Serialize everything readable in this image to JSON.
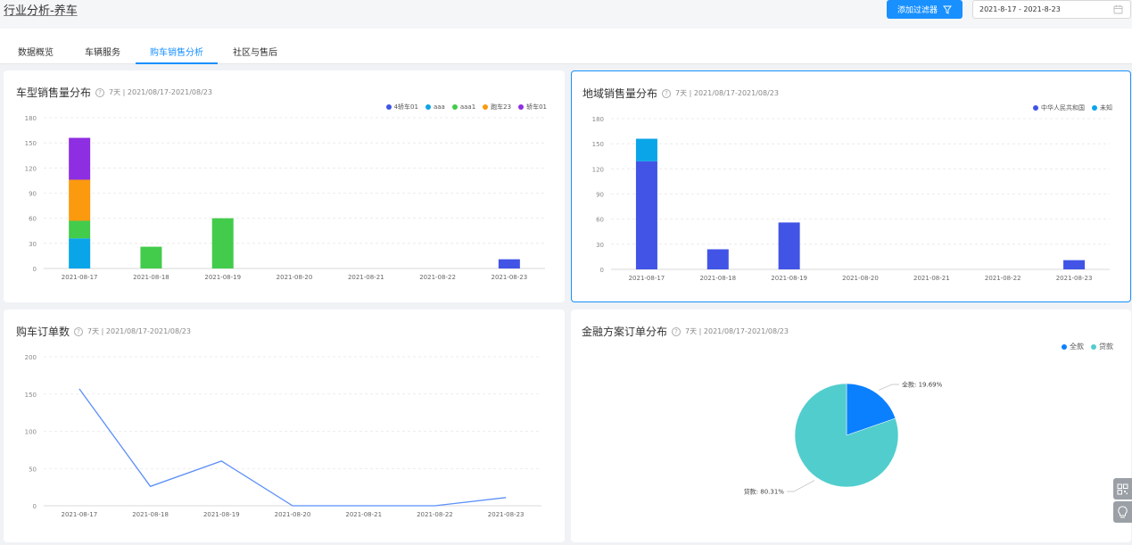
{
  "header": {
    "title": "行业分析-养车",
    "filter_button": "添加过滤器",
    "date_range": "2021-8-17 - 2021-8-23"
  },
  "tabs": [
    {
      "label": "数据概览",
      "active": false
    },
    {
      "label": "车辆服务",
      "active": false
    },
    {
      "label": "购车销售分析",
      "active": true
    },
    {
      "label": "社区与售后",
      "active": false
    }
  ],
  "cards": {
    "model_sales": {
      "title": "车型销售量分布",
      "help": "?",
      "meta": "7天 | 2021/08/17-2021/08/23"
    },
    "region_sales": {
      "title": "地域销售量分布",
      "help": "?",
      "meta": "7天 | 2021/08/17-2021/08/23"
    },
    "orders": {
      "title": "购车订单数",
      "help": "?",
      "meta": "7天 | 2021/08/17-2021/08/23"
    },
    "finance": {
      "title": "金融方案订单分布",
      "help": "?",
      "meta": "7天 | 2021/08/17-2021/08/23"
    }
  },
  "colors": {
    "accent": "#1890ff",
    "blue": "#4154e6",
    "cyan": "#0aa5e8",
    "green": "#43cb4c",
    "orange": "#fb9a0e",
    "purple": "#8e2ee2",
    "pie_full": "#0a80ff",
    "pie_loan": "#52cdcd"
  },
  "chart_data": [
    {
      "type": "bar",
      "stacked": true,
      "title": "车型销售量分布",
      "categories": [
        "2021-08-17",
        "2021-08-18",
        "2021-08-19",
        "2021-08-20",
        "2021-08-21",
        "2021-08-22",
        "2021-08-23"
      ],
      "ylim": [
        0,
        180
      ],
      "yticks": [
        0,
        30,
        60,
        90,
        120,
        150,
        180
      ],
      "legend_position": "top-right",
      "series": [
        {
          "name": "4轿车01",
          "color": "#4154e6",
          "values": [
            0,
            0,
            0,
            0,
            0,
            0,
            11
          ]
        },
        {
          "name": "aaa",
          "color": "#0aa5e8",
          "values": [
            36,
            0,
            0,
            0,
            0,
            0,
            0
          ]
        },
        {
          "name": "aaa1",
          "color": "#43cb4c",
          "values": [
            21,
            26,
            60,
            0,
            0,
            0,
            0
          ]
        },
        {
          "name": "跑车23",
          "color": "#fb9a0e",
          "values": [
            49,
            0,
            0,
            0,
            0,
            0,
            0
          ]
        },
        {
          "name": "轿车01",
          "color": "#8e2ee2",
          "values": [
            50,
            0,
            0,
            0,
            0,
            0,
            0
          ]
        }
      ]
    },
    {
      "type": "bar",
      "stacked": true,
      "title": "地域销售量分布",
      "categories": [
        "2021-08-17",
        "2021-08-18",
        "2021-08-19",
        "2021-08-20",
        "2021-08-21",
        "2021-08-22",
        "2021-08-23"
      ],
      "ylim": [
        0,
        180
      ],
      "yticks": [
        0,
        30,
        60,
        90,
        120,
        150,
        180
      ],
      "legend_position": "top-right",
      "series": [
        {
          "name": "中华人民共和国",
          "color": "#4154e6",
          "values": [
            129,
            24,
            56,
            0,
            0,
            0,
            11
          ]
        },
        {
          "name": "未知",
          "color": "#0aa5e8",
          "values": [
            27,
            0,
            0,
            0,
            0,
            0,
            0
          ]
        }
      ]
    },
    {
      "type": "line",
      "title": "购车订单数",
      "categories": [
        "2021-08-17",
        "2021-08-18",
        "2021-08-19",
        "2021-08-20",
        "2021-08-21",
        "2021-08-22",
        "2021-08-23"
      ],
      "ylim": [
        0,
        200
      ],
      "yticks": [
        0,
        50,
        100,
        150,
        200
      ],
      "series": [
        {
          "color": "#5b8ff9",
          "values": [
            157,
            26,
            60,
            0,
            0,
            0,
            11
          ]
        }
      ]
    },
    {
      "type": "pie",
      "title": "金融方案订单分布",
      "legend_position": "top-right",
      "slices": [
        {
          "name": "全款",
          "value": 19.69,
          "label": "全款: 19.69%",
          "color": "#0a80ff"
        },
        {
          "name": "贷款",
          "value": 80.31,
          "label": "贷款: 80.31%",
          "color": "#52cdcd"
        }
      ]
    }
  ]
}
